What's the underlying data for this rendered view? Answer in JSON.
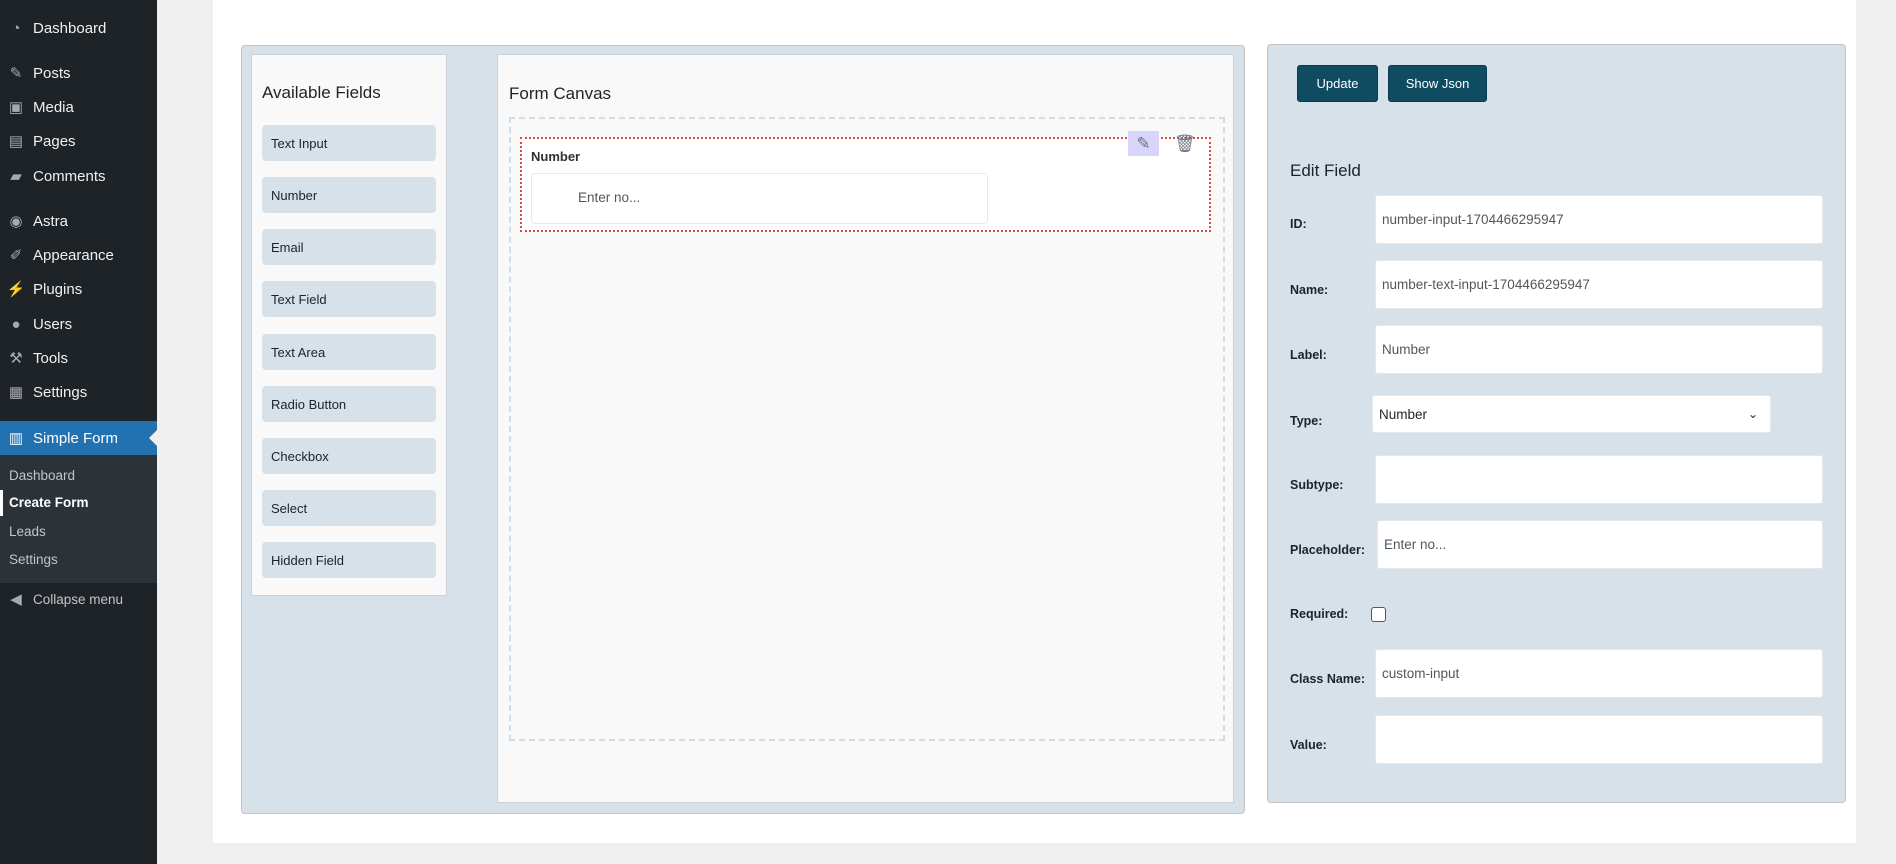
{
  "sidebar": {
    "menu": [
      {
        "label": "Dashboard",
        "icon": "dashboard-icon"
      },
      {
        "label": "Posts",
        "icon": "pin-icon"
      },
      {
        "label": "Media",
        "icon": "media-icon"
      },
      {
        "label": "Pages",
        "icon": "pages-icon"
      },
      {
        "label": "Comments",
        "icon": "comment-icon"
      },
      {
        "label": "Astra",
        "icon": "astra-icon"
      },
      {
        "label": "Appearance",
        "icon": "brush-icon"
      },
      {
        "label": "Plugins",
        "icon": "plugin-icon"
      },
      {
        "label": "Users",
        "icon": "user-icon"
      },
      {
        "label": "Tools",
        "icon": "wrench-icon"
      },
      {
        "label": "Settings",
        "icon": "settings-icon"
      },
      {
        "label": "Simple Form",
        "icon": "clipboard-icon"
      }
    ],
    "submenu": [
      "Dashboard",
      "Create Form",
      "Leads",
      "Settings"
    ],
    "collapse": "Collapse menu"
  },
  "available": {
    "title": "Available Fields",
    "items": [
      "Text Input",
      "Number",
      "Email",
      "Text Field",
      "Text Area",
      "Radio Button",
      "Checkbox",
      "Select",
      "Hidden Field"
    ]
  },
  "canvas": {
    "title": "Form Canvas",
    "field": {
      "label": "Number",
      "placeholder": "Enter no..."
    }
  },
  "editor": {
    "update": "Update",
    "show_json": "Show Json",
    "title": "Edit Field",
    "fields": {
      "id": {
        "label": "ID:",
        "value": "number-input-1704466295947"
      },
      "name": {
        "label": "Name:",
        "value": "number-text-input-1704466295947"
      },
      "flabel": {
        "label": "Label:",
        "value": "Number"
      },
      "type": {
        "label": "Type:",
        "value": "Number"
      },
      "subtype": {
        "label": "Subtype:",
        "value": ""
      },
      "placeholder": {
        "label": "Placeholder:",
        "value": "Enter no..."
      },
      "required": {
        "label": "Required:",
        "checked": false
      },
      "classname": {
        "label": "Class Name:",
        "value": "custom-input"
      },
      "value": {
        "label": "Value:",
        "value": ""
      }
    }
  },
  "colors": {
    "sidebar": "#1d2327",
    "active": "#2271b1",
    "button": "#0f4c62",
    "panel": "#d7e1e9",
    "selected_border": "#d04a4a"
  }
}
